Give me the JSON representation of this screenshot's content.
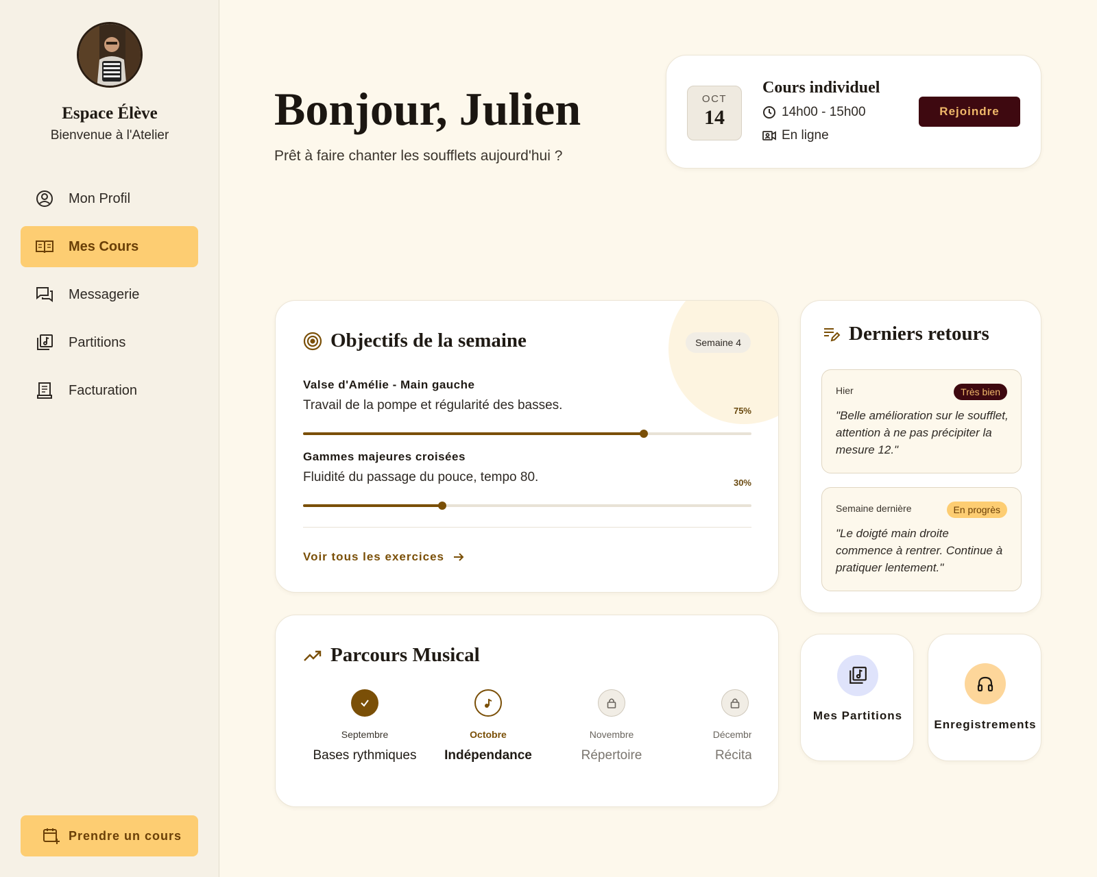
{
  "sidebar": {
    "title": "Espace Élève",
    "subtitle": "Bienvenue à l'Atelier",
    "items": [
      {
        "label": "Mon Profil",
        "icon": "user-circle-icon"
      },
      {
        "label": "Mes Cours",
        "icon": "book-open-icon",
        "active": true
      },
      {
        "label": "Messagerie",
        "icon": "chat-icon"
      },
      {
        "label": "Partitions",
        "icon": "sheet-music-icon"
      },
      {
        "label": "Facturation",
        "icon": "receipt-icon"
      }
    ],
    "cta_label": "Prendre un cours"
  },
  "header": {
    "greeting": "Bonjour, Julien",
    "subtitle": "Prêt à faire chanter les soufflets aujourd'hui ?"
  },
  "next_lesson": {
    "month": "OCT",
    "day": "14",
    "title": "Cours individuel",
    "time": "14h00 - 15h00",
    "mode": "En ligne",
    "join_label": "Rejoindre"
  },
  "objectives": {
    "title": "Objectifs de la semaine",
    "week_badge": "Semaine 4",
    "goals": [
      {
        "name": "Valse d'Amélie - Main gauche",
        "desc": "Travail de la pompe et régularité des basses.",
        "pct_label": "75%",
        "progress": 0.76
      },
      {
        "name": "Gammes majeures croisées",
        "desc": "Fluidité du passage du pouce, tempo 80.",
        "pct_label": "30%",
        "progress": 0.31
      }
    ],
    "link_label": "Voir tous les exercices"
  },
  "feedback": {
    "title": "Derniers retours",
    "items": [
      {
        "when": "Hier",
        "badge": "Très bien",
        "quote": "\"Belle amélioration sur le soufflet, attention à ne pas précipiter la mesure 12.\""
      },
      {
        "when": "Semaine dernière",
        "badge": "En progrès",
        "quote": "\"Le doigté main droite commence à rentrer. Continue à pratiquer lentement.\""
      }
    ]
  },
  "journey": {
    "title": "Parcours Musical",
    "steps": [
      {
        "month": "Septembre",
        "label": "Bases rythmiques",
        "state": "done"
      },
      {
        "month": "Octobre",
        "label": "Indépendance",
        "state": "current"
      },
      {
        "month": "Novembre",
        "label": "Répertoire",
        "state": "locked"
      },
      {
        "month": "Décembre",
        "label": "Récital",
        "state": "locked"
      }
    ]
  },
  "tiles": {
    "partitions": {
      "label": "Mes Partitions",
      "icon": "sheet-music-icon",
      "color": "#dfe3fb"
    },
    "recordings": {
      "label": "Enregistrements",
      "icon": "headphones-icon",
      "color": "#fdd69a"
    }
  },
  "colors": {
    "accent": "#fdcd72",
    "brown": "#7a4f07",
    "burgundy": "#3e0910",
    "background": "#fdf8ec"
  }
}
